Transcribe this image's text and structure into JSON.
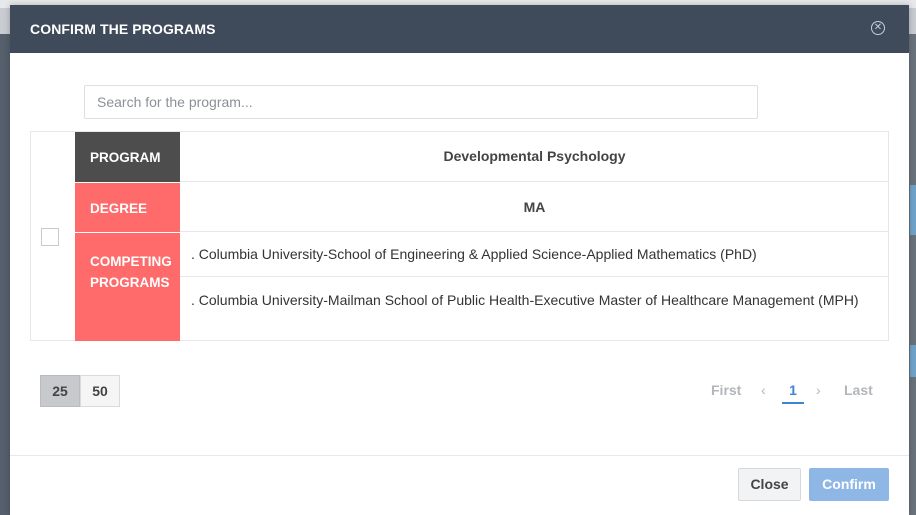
{
  "modal": {
    "title": "CONFIRM THE PROGRAMS"
  },
  "search": {
    "placeholder": "Search for the program..."
  },
  "program_card": {
    "labels": {
      "program": "PROGRAM",
      "degree": "DEGREE",
      "competing": "COMPETING PROGRAMS"
    },
    "program": "Developmental Psychology",
    "degree": "MA",
    "competing_programs": [
      ". Columbia University-School of Engineering & Applied Science-Applied Mathematics (PhD)",
      ". Columbia University-Mailman School of Public Health-Executive Master of Healthcare Management (MPH)"
    ],
    "checked": false
  },
  "page_size": {
    "options": [
      "25",
      "50"
    ],
    "selected": "25"
  },
  "pagination": {
    "first": "First",
    "prev": "‹",
    "current": "1",
    "next": "›",
    "last": "Last"
  },
  "footer": {
    "close_label": "Close",
    "confirm_label": "Confirm"
  },
  "colors": {
    "header": "#3f4b5b",
    "program_label": "#4d4d4d",
    "accent_red": "#ff6a6a",
    "confirm_button": "#8fb7e6",
    "active_page": "#3a86d4"
  },
  "icons": {
    "close": "close-circle-icon"
  }
}
